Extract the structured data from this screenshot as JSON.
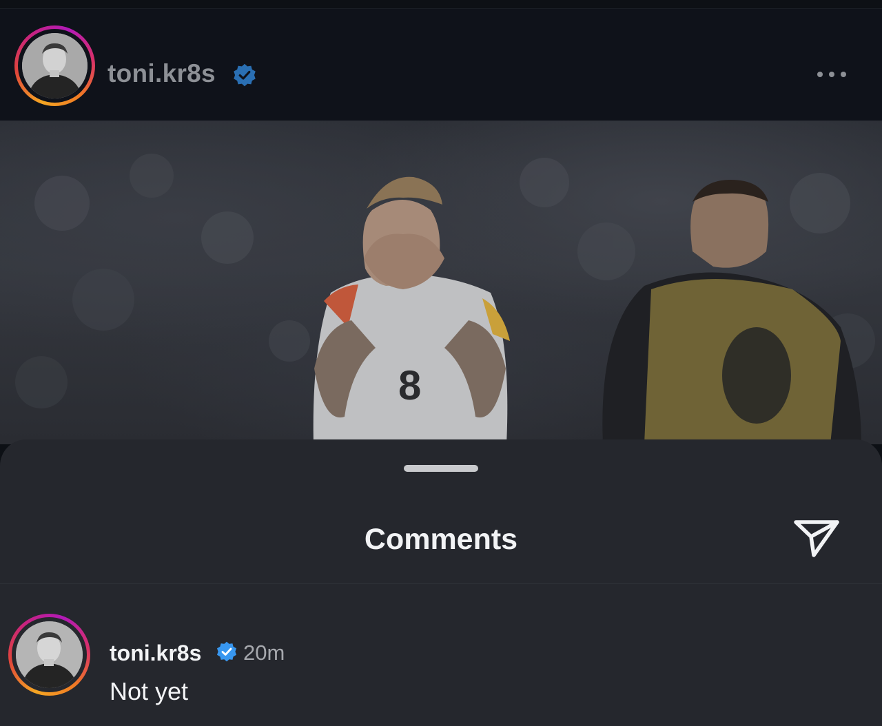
{
  "post": {
    "username": "toni.kr8s",
    "verified": true,
    "avatar": "profile-photo",
    "more_icon": "more-horizontal-icon",
    "image": "match-photo"
  },
  "comments_sheet": {
    "title": "Comments",
    "share_icon": "send-icon",
    "comments": [
      {
        "username": "toni.kr8s",
        "verified": true,
        "time": "20m",
        "text": "Not yet"
      }
    ]
  },
  "colors": {
    "verified_badge": "#3897f0",
    "sheet_background": "#25272d",
    "header_background": "#0f121a"
  }
}
